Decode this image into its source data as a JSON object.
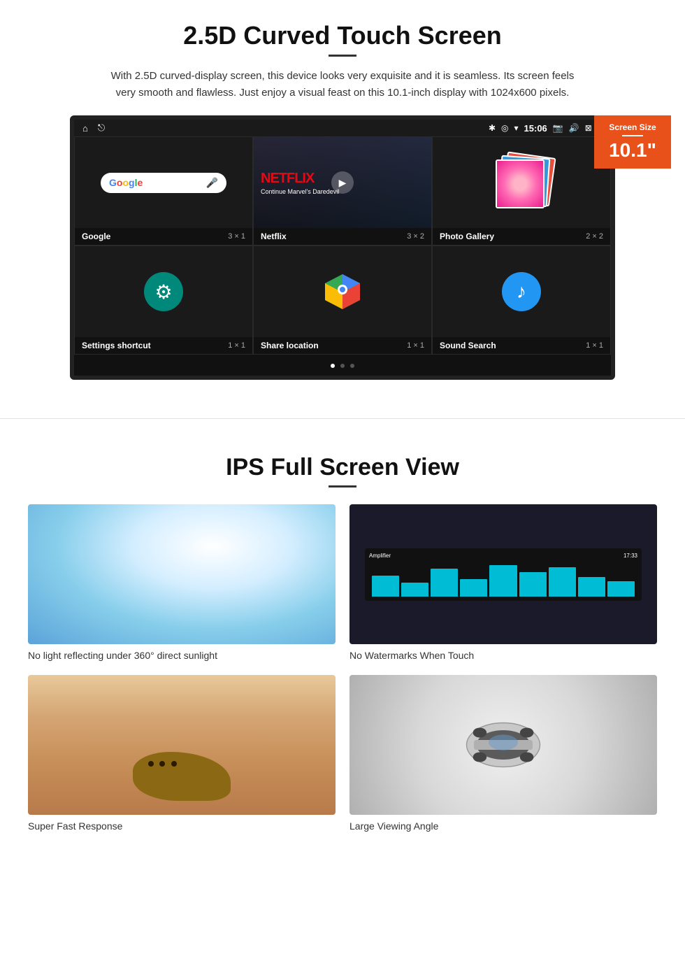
{
  "section1": {
    "title": "2.5D Curved Touch Screen",
    "description": "With 2.5D curved-display screen, this device looks very exquisite and it is seamless. Its screen feels very smooth and flawless. Just enjoy a visual feast on this 10.1-inch display with 1024x600 pixels.",
    "badge": {
      "label": "Screen Size",
      "size": "10.1\""
    },
    "status_bar": {
      "time": "15:06"
    },
    "apps": [
      {
        "name": "Google",
        "size": "3 × 1"
      },
      {
        "name": "Netflix",
        "size": "3 × 2"
      },
      {
        "name": "Photo Gallery",
        "size": "2 × 2"
      },
      {
        "name": "Settings shortcut",
        "size": "1 × 1"
      },
      {
        "name": "Share location",
        "size": "1 × 1"
      },
      {
        "name": "Sound Search",
        "size": "1 × 1"
      }
    ],
    "netflix": {
      "logo": "NETFLIX",
      "subtitle": "Continue Marvel's Daredevil"
    }
  },
  "section2": {
    "title": "IPS Full Screen View",
    "features": [
      {
        "label": "No light reflecting under 360° direct sunlight",
        "img_type": "sky"
      },
      {
        "label": "No Watermarks When Touch",
        "img_type": "amplifier"
      },
      {
        "label": "Super Fast Response",
        "img_type": "cheetah"
      },
      {
        "label": "Large Viewing Angle",
        "img_type": "car"
      }
    ]
  }
}
